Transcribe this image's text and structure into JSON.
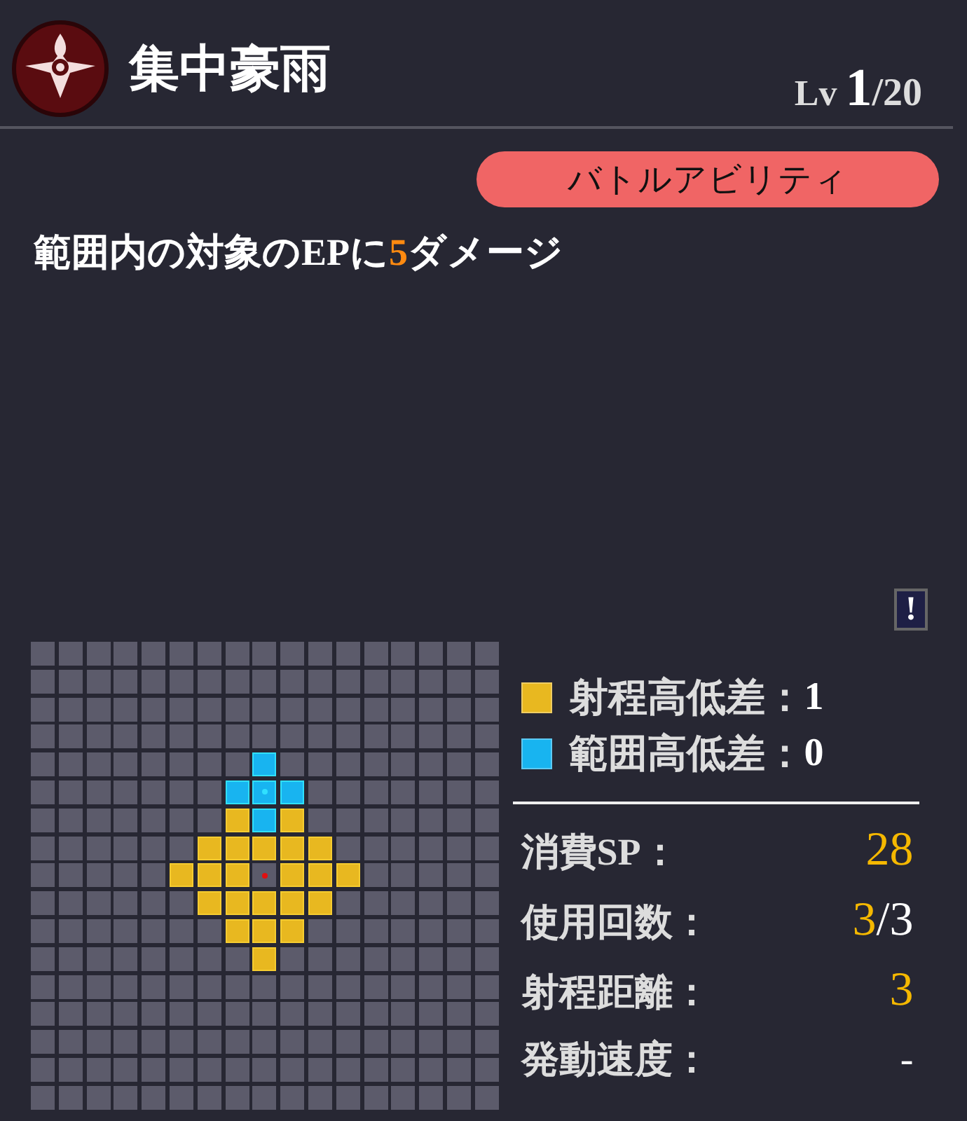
{
  "header": {
    "title": "集中豪雨",
    "level_label": "Lv",
    "level": "1",
    "level_max": "/20"
  },
  "badge": "バトルアビリティ",
  "description": {
    "before": "範囲内の対象のEPに",
    "amount": "5",
    "after": "ダメージ"
  },
  "info_button": "!",
  "grid": {
    "rows": [
      [
        {
          "kind": "empty"
        },
        {
          "kind": "empty"
        },
        {
          "kind": "empty"
        },
        {
          "kind": "empty"
        },
        {
          "kind": "empty"
        },
        {
          "kind": "empty"
        },
        {
          "kind": "empty"
        },
        {
          "kind": "empty"
        },
        {
          "kind": "empty"
        },
        {
          "kind": "empty"
        },
        {
          "kind": "empty"
        },
        {
          "kind": "empty"
        },
        {
          "kind": "empty"
        },
        {
          "kind": "empty"
        },
        {
          "kind": "empty"
        },
        {
          "kind": "empty"
        },
        {
          "kind": "empty"
        }
      ],
      [
        {
          "kind": "empty"
        },
        {
          "kind": "empty"
        },
        {
          "kind": "empty"
        },
        {
          "kind": "empty"
        },
        {
          "kind": "empty"
        },
        {
          "kind": "empty"
        },
        {
          "kind": "empty"
        },
        {
          "kind": "empty"
        },
        {
          "kind": "empty"
        },
        {
          "kind": "empty"
        },
        {
          "kind": "empty"
        },
        {
          "kind": "empty"
        },
        {
          "kind": "empty"
        },
        {
          "kind": "empty"
        },
        {
          "kind": "empty"
        },
        {
          "kind": "empty"
        },
        {
          "kind": "empty"
        }
      ],
      [
        {
          "kind": "empty"
        },
        {
          "kind": "empty"
        },
        {
          "kind": "empty"
        },
        {
          "kind": "empty"
        },
        {
          "kind": "empty"
        },
        {
          "kind": "empty"
        },
        {
          "kind": "empty"
        },
        {
          "kind": "empty"
        },
        {
          "kind": "empty"
        },
        {
          "kind": "empty"
        },
        {
          "kind": "empty"
        },
        {
          "kind": "empty"
        },
        {
          "kind": "empty"
        },
        {
          "kind": "empty"
        },
        {
          "kind": "empty"
        },
        {
          "kind": "empty"
        },
        {
          "kind": "empty"
        }
      ],
      [
        {
          "kind": "empty"
        },
        {
          "kind": "empty"
        },
        {
          "kind": "empty"
        },
        {
          "kind": "empty"
        },
        {
          "kind": "empty"
        },
        {
          "kind": "empty"
        },
        {
          "kind": "empty"
        },
        {
          "kind": "empty"
        },
        {
          "kind": "empty"
        },
        {
          "kind": "empty"
        },
        {
          "kind": "empty"
        },
        {
          "kind": "empty"
        },
        {
          "kind": "empty"
        },
        {
          "kind": "empty"
        },
        {
          "kind": "empty"
        },
        {
          "kind": "empty"
        },
        {
          "kind": "empty"
        }
      ],
      [
        {
          "kind": "empty"
        },
        {
          "kind": "empty"
        },
        {
          "kind": "empty"
        },
        {
          "kind": "empty"
        },
        {
          "kind": "empty"
        },
        {
          "kind": "empty"
        },
        {
          "kind": "empty"
        },
        {
          "kind": "empty"
        },
        {
          "kind": "area"
        },
        {
          "kind": "empty"
        },
        {
          "kind": "empty"
        },
        {
          "kind": "empty"
        },
        {
          "kind": "empty"
        },
        {
          "kind": "empty"
        },
        {
          "kind": "empty"
        },
        {
          "kind": "empty"
        },
        {
          "kind": "empty"
        }
      ],
      [
        {
          "kind": "empty"
        },
        {
          "kind": "empty"
        },
        {
          "kind": "empty"
        },
        {
          "kind": "empty"
        },
        {
          "kind": "empty"
        },
        {
          "kind": "empty"
        },
        {
          "kind": "empty"
        },
        {
          "kind": "area"
        },
        {
          "kind": "area_center"
        },
        {
          "kind": "area"
        },
        {
          "kind": "empty"
        },
        {
          "kind": "empty"
        },
        {
          "kind": "empty"
        },
        {
          "kind": "empty"
        },
        {
          "kind": "empty"
        },
        {
          "kind": "empty"
        },
        {
          "kind": "empty"
        }
      ],
      [
        {
          "kind": "empty"
        },
        {
          "kind": "empty"
        },
        {
          "kind": "empty"
        },
        {
          "kind": "empty"
        },
        {
          "kind": "empty"
        },
        {
          "kind": "empty"
        },
        {
          "kind": "empty"
        },
        {
          "kind": "range"
        },
        {
          "kind": "area"
        },
        {
          "kind": "range"
        },
        {
          "kind": "empty"
        },
        {
          "kind": "empty"
        },
        {
          "kind": "empty"
        },
        {
          "kind": "empty"
        },
        {
          "kind": "empty"
        },
        {
          "kind": "empty"
        },
        {
          "kind": "empty"
        }
      ],
      [
        {
          "kind": "empty"
        },
        {
          "kind": "empty"
        },
        {
          "kind": "empty"
        },
        {
          "kind": "empty"
        },
        {
          "kind": "empty"
        },
        {
          "kind": "empty"
        },
        {
          "kind": "range"
        },
        {
          "kind": "range"
        },
        {
          "kind": "range"
        },
        {
          "kind": "range"
        },
        {
          "kind": "range"
        },
        {
          "kind": "empty"
        },
        {
          "kind": "empty"
        },
        {
          "kind": "empty"
        },
        {
          "kind": "empty"
        },
        {
          "kind": "empty"
        },
        {
          "kind": "empty"
        }
      ],
      [
        {
          "kind": "empty"
        },
        {
          "kind": "empty"
        },
        {
          "kind": "empty"
        },
        {
          "kind": "empty"
        },
        {
          "kind": "empty"
        },
        {
          "kind": "range"
        },
        {
          "kind": "range"
        },
        {
          "kind": "range"
        },
        {
          "kind": "origin"
        },
        {
          "kind": "range"
        },
        {
          "kind": "range"
        },
        {
          "kind": "range"
        },
        {
          "kind": "empty"
        },
        {
          "kind": "empty"
        },
        {
          "kind": "empty"
        },
        {
          "kind": "empty"
        },
        {
          "kind": "empty"
        }
      ],
      [
        {
          "kind": "empty"
        },
        {
          "kind": "empty"
        },
        {
          "kind": "empty"
        },
        {
          "kind": "empty"
        },
        {
          "kind": "empty"
        },
        {
          "kind": "empty"
        },
        {
          "kind": "range"
        },
        {
          "kind": "range"
        },
        {
          "kind": "range"
        },
        {
          "kind": "range"
        },
        {
          "kind": "range"
        },
        {
          "kind": "empty"
        },
        {
          "kind": "empty"
        },
        {
          "kind": "empty"
        },
        {
          "kind": "empty"
        },
        {
          "kind": "empty"
        },
        {
          "kind": "empty"
        }
      ],
      [
        {
          "kind": "empty"
        },
        {
          "kind": "empty"
        },
        {
          "kind": "empty"
        },
        {
          "kind": "empty"
        },
        {
          "kind": "empty"
        },
        {
          "kind": "empty"
        },
        {
          "kind": "empty"
        },
        {
          "kind": "range"
        },
        {
          "kind": "range"
        },
        {
          "kind": "range"
        },
        {
          "kind": "empty"
        },
        {
          "kind": "empty"
        },
        {
          "kind": "empty"
        },
        {
          "kind": "empty"
        },
        {
          "kind": "empty"
        },
        {
          "kind": "empty"
        },
        {
          "kind": "empty"
        }
      ],
      [
        {
          "kind": "empty"
        },
        {
          "kind": "empty"
        },
        {
          "kind": "empty"
        },
        {
          "kind": "empty"
        },
        {
          "kind": "empty"
        },
        {
          "kind": "empty"
        },
        {
          "kind": "empty"
        },
        {
          "kind": "empty"
        },
        {
          "kind": "range"
        },
        {
          "kind": "empty"
        },
        {
          "kind": "empty"
        },
        {
          "kind": "empty"
        },
        {
          "kind": "empty"
        },
        {
          "kind": "empty"
        },
        {
          "kind": "empty"
        },
        {
          "kind": "empty"
        },
        {
          "kind": "empty"
        }
      ],
      [
        {
          "kind": "empty"
        },
        {
          "kind": "empty"
        },
        {
          "kind": "empty"
        },
        {
          "kind": "empty"
        },
        {
          "kind": "empty"
        },
        {
          "kind": "empty"
        },
        {
          "kind": "empty"
        },
        {
          "kind": "empty"
        },
        {
          "kind": "empty"
        },
        {
          "kind": "empty"
        },
        {
          "kind": "empty"
        },
        {
          "kind": "empty"
        },
        {
          "kind": "empty"
        },
        {
          "kind": "empty"
        },
        {
          "kind": "empty"
        },
        {
          "kind": "empty"
        },
        {
          "kind": "empty"
        }
      ],
      [
        {
          "kind": "empty"
        },
        {
          "kind": "empty"
        },
        {
          "kind": "empty"
        },
        {
          "kind": "empty"
        },
        {
          "kind": "empty"
        },
        {
          "kind": "empty"
        },
        {
          "kind": "empty"
        },
        {
          "kind": "empty"
        },
        {
          "kind": "empty"
        },
        {
          "kind": "empty"
        },
        {
          "kind": "empty"
        },
        {
          "kind": "empty"
        },
        {
          "kind": "empty"
        },
        {
          "kind": "empty"
        },
        {
          "kind": "empty"
        },
        {
          "kind": "empty"
        },
        {
          "kind": "empty"
        }
      ],
      [
        {
          "kind": "empty"
        },
        {
          "kind": "empty"
        },
        {
          "kind": "empty"
        },
        {
          "kind": "empty"
        },
        {
          "kind": "empty"
        },
        {
          "kind": "empty"
        },
        {
          "kind": "empty"
        },
        {
          "kind": "empty"
        },
        {
          "kind": "empty"
        },
        {
          "kind": "empty"
        },
        {
          "kind": "empty"
        },
        {
          "kind": "empty"
        },
        {
          "kind": "empty"
        },
        {
          "kind": "empty"
        },
        {
          "kind": "empty"
        },
        {
          "kind": "empty"
        },
        {
          "kind": "empty"
        }
      ],
      [
        {
          "kind": "empty"
        },
        {
          "kind": "empty"
        },
        {
          "kind": "empty"
        },
        {
          "kind": "empty"
        },
        {
          "kind": "empty"
        },
        {
          "kind": "empty"
        },
        {
          "kind": "empty"
        },
        {
          "kind": "empty"
        },
        {
          "kind": "empty"
        },
        {
          "kind": "empty"
        },
        {
          "kind": "empty"
        },
        {
          "kind": "empty"
        },
        {
          "kind": "empty"
        },
        {
          "kind": "empty"
        },
        {
          "kind": "empty"
        },
        {
          "kind": "empty"
        },
        {
          "kind": "empty"
        }
      ],
      [
        {
          "kind": "empty"
        },
        {
          "kind": "empty"
        },
        {
          "kind": "empty"
        },
        {
          "kind": "empty"
        },
        {
          "kind": "empty"
        },
        {
          "kind": "empty"
        },
        {
          "kind": "empty"
        },
        {
          "kind": "empty"
        },
        {
          "kind": "empty"
        },
        {
          "kind": "empty"
        },
        {
          "kind": "empty"
        },
        {
          "kind": "empty"
        },
        {
          "kind": "empty"
        },
        {
          "kind": "empty"
        },
        {
          "kind": "empty"
        },
        {
          "kind": "empty"
        },
        {
          "kind": "empty"
        }
      ]
    ]
  },
  "legend": [
    {
      "color": "#e8b820",
      "label": "射程高低差",
      "separator": "：",
      "value": "1"
    },
    {
      "color": "#18b4f0",
      "label": "範囲高低差",
      "separator": "：",
      "value": "0"
    }
  ],
  "stats": [
    {
      "label": "消費SP：",
      "value": "28"
    },
    {
      "label": "使用回数：",
      "value": "3",
      "max": "/3"
    },
    {
      "label": "射程距離：",
      "value": "3"
    },
    {
      "label": "発動速度：",
      "value": "-",
      "kind": "none"
    }
  ]
}
